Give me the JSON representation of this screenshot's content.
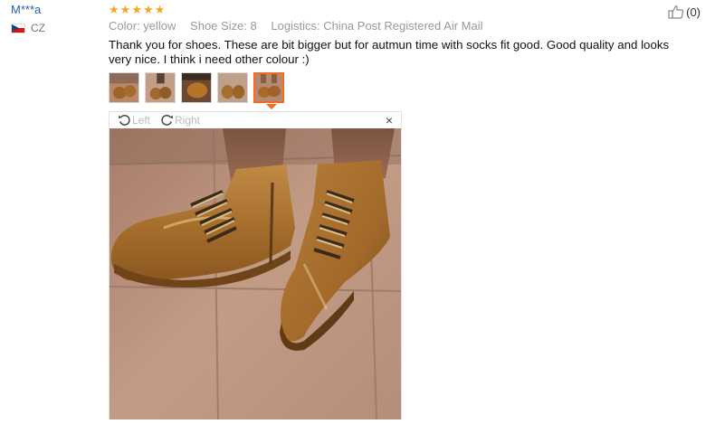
{
  "reviewer": {
    "name": "M***a",
    "country_code": "CZ"
  },
  "rating": {
    "stars": 5,
    "max": 5
  },
  "helpful": {
    "count_label": "(0)"
  },
  "attributes": {
    "color": "Color: yellow",
    "shoe_size": "Shoe Size: 8",
    "logistics": "Logistics: China Post Registered Air Mail"
  },
  "review_text": "Thank you for shoes. These are bit bigger but for autmun time with socks fit good. Good quality and looks very nice. I think i need other colour :)",
  "thumbnails": {
    "count": 5,
    "active_index": 4
  },
  "viewer": {
    "rotate_left_label": "Left",
    "rotate_right_label": "Right",
    "close_label": "×"
  },
  "colors": {
    "star": "#f5a623",
    "accent": "#f56b20",
    "link": "#2a5fa8"
  }
}
